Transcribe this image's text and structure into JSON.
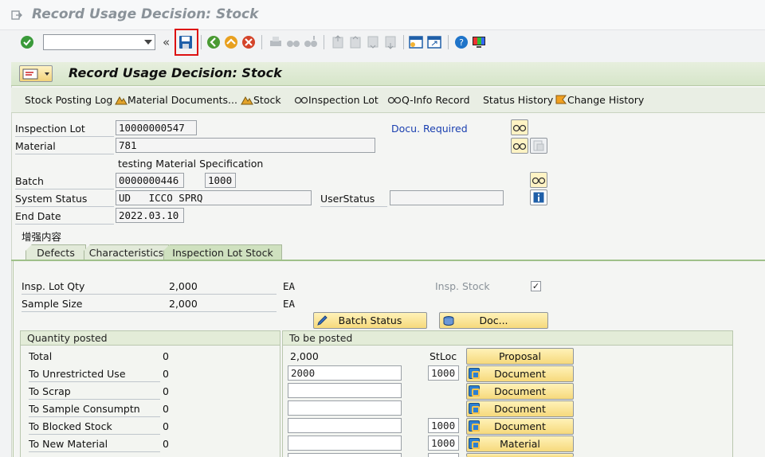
{
  "window": {
    "title": "Record Usage Decision: Stock"
  },
  "toolbar": {
    "command_field": "",
    "collapse": "«"
  },
  "header": {
    "title": "Record Usage Decision: Stock"
  },
  "app_buttons": [
    {
      "label": "Stock Posting Log"
    },
    {
      "label": "Material Documents..."
    },
    {
      "label": "Stock"
    },
    {
      "label": "Inspection Lot"
    },
    {
      "label": "Q-Info Record"
    },
    {
      "label": "Status History"
    },
    {
      "label": "Change History"
    }
  ],
  "form": {
    "inspection_lot_label": "Inspection Lot",
    "inspection_lot": "10000000547",
    "docu_required": "Docu. Required",
    "material_label": "Material",
    "material": "781",
    "material_desc": "testing Material Specification",
    "batch_label": "Batch",
    "batch": "0000000446",
    "plant": "1000",
    "system_status_label": "System Status",
    "system_status": "UD   ICCO SPRQ",
    "user_status_label": "UserStatus",
    "user_status": "",
    "end_date_label": "End Date",
    "end_date": "2022.03.10",
    "enhanced_content": "增强内容"
  },
  "tabs": [
    {
      "label": "Defects"
    },
    {
      "label": "Characteristics"
    },
    {
      "label": "Inspection Lot Stock"
    }
  ],
  "stock": {
    "insp_lot_qty_label": "Insp. Lot Qty",
    "insp_lot_qty": "2,000",
    "insp_lot_qty_unit": "EA",
    "sample_size_label": "Sample Size",
    "sample_size": "2,000",
    "sample_size_unit": "EA",
    "insp_stock_label": "Insp. Stock",
    "insp_stock_checked": "✓",
    "batch_status_button": "Batch Status",
    "doc_button": "Doc..."
  },
  "qty_posted": {
    "title": "Quantity posted",
    "rows": [
      {
        "label": "Total",
        "value": "0"
      },
      {
        "label": "To Unrestricted Use",
        "value": "0"
      },
      {
        "label": "To Scrap",
        "value": "0"
      },
      {
        "label": "To Sample Consumptn",
        "value": "0"
      },
      {
        "label": "To Blocked Stock",
        "value": "0"
      },
      {
        "label": "To New Material",
        "value": "0"
      }
    ]
  },
  "to_be_posted": {
    "title": "To be posted",
    "total": "2,000",
    "stloc_label": "StLoc",
    "proposal_button": "Proposal",
    "rows": [
      {
        "qty": "2000",
        "stloc": "1000",
        "button": "Document"
      },
      {
        "qty": "",
        "stloc": "",
        "button": "Document"
      },
      {
        "qty": "",
        "stloc": "",
        "button": "Document"
      },
      {
        "qty": "",
        "stloc": "1000",
        "button": "Document"
      },
      {
        "qty": "",
        "stloc": "1000",
        "button": "Material"
      }
    ]
  }
}
